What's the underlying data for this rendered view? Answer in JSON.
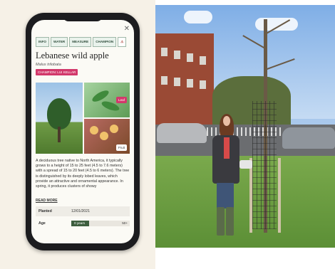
{
  "app": {
    "tabs": [
      {
        "label": "INFO"
      },
      {
        "label": "WATER"
      },
      {
        "label": "MEASURE"
      },
      {
        "label": "CHAMPION"
      }
    ],
    "close_label": "✕",
    "warning_icon": "warning-icon",
    "title": "Lebanese wild apple",
    "latin_name": "Malus trilobata",
    "badge": "CHAMPION: LUI KELLAR",
    "photo_labels": {
      "leaf": "Leaf",
      "fruit": "Fruit"
    },
    "description": "A deciduous tree native to North America, it typically grows to a height of 15 to 25 feet (4.5 to 7.6 meters) with a spread of 15 to 20 feet (4.5 to 6 meters). The tree is distinguished by its deeply lobed leaves, which provide an attractive and ornamental appearance. In spring, it produces clusters of showy",
    "read_more": "READ MORE",
    "planted": {
      "label": "Planted",
      "value": "12/01/2021"
    },
    "age": {
      "label": "Age",
      "value": "0 years",
      "max": "50+",
      "fill_fraction": 0.3
    }
  },
  "colors": {
    "accent_pink": "#d2386b",
    "tab_green": "#e9f2ec",
    "age_bar": "#3d5e3e"
  }
}
